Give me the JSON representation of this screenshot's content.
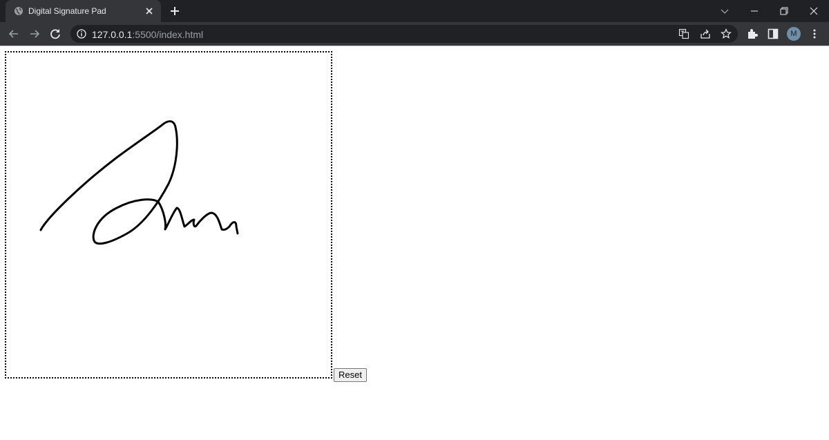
{
  "browser": {
    "tab_title": "Digital Signature Pad",
    "url_host": "127.0.0.1",
    "url_path": ":5500/index.html",
    "profile_initial": "M",
    "icons": [
      "globe-icon",
      "close-icon",
      "plus-icon",
      "chevron-down-icon",
      "minimize-icon",
      "restore-icon",
      "close-window-icon",
      "back-icon",
      "forward-icon",
      "reload-icon",
      "info-icon",
      "translate-icon",
      "share-icon",
      "star-icon",
      "extensions-icon",
      "side-panel-icon",
      "menu-icon"
    ]
  },
  "page": {
    "reset_label": "Reset"
  },
  "colors": {
    "chrome_dark": "#202124",
    "chrome_tab": "#35363a",
    "ink": "#000000"
  }
}
